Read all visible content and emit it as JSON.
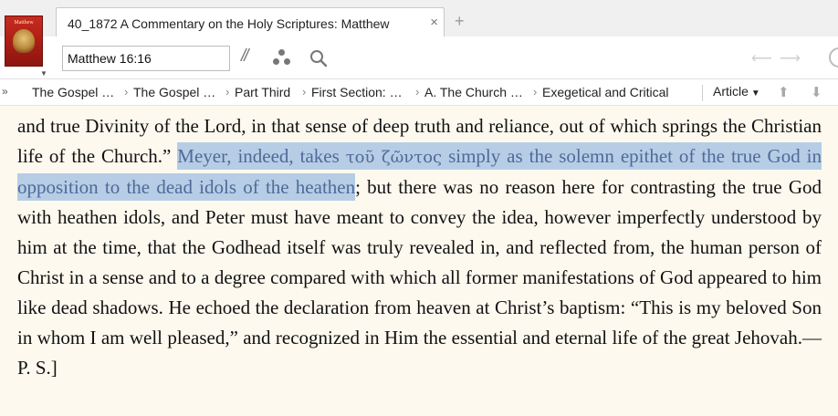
{
  "resource": {
    "cover_title": "Matthew"
  },
  "tab": {
    "title": "40_1872 A Commentary on the Holy Scriptures: Matthew",
    "close_glyph": "×",
    "new_tab_glyph": "+"
  },
  "toolbar": {
    "reference_value": "Matthew 16:16",
    "parallel_glyph": "//"
  },
  "breadcrumbs": {
    "overflow_glyph": "»",
    "items": [
      "The Gospel …",
      "The Gospel …",
      "Part Third",
      "First Section: …",
      "A. The Church …",
      "Exegetical and Critical"
    ],
    "separator": "›",
    "article_label": "Article"
  },
  "content": {
    "before": "and true Divinity of the Lord, in that sense of deep truth and reliance, out of which springs the Christian life of the Church.” ",
    "hl_a": "Meyer, indeed, takes ",
    "hl_greek": "τοῦ ζῶντος",
    "hl_b": "  simply as the solemn epithet of the true God in opposition to the dead idols of the heathen",
    "after": "; but there was no reason here for contrasting the true God with heathen idols, and Peter must have meant to convey the idea, however imperfectly understood by him at the time, that the Godhead itself was truly revealed in, and reflected from, the human person of Christ in a sense and to a degree compared with which all former manifestations of God appeared to him like dead shadows. He echoed the declaration from heaven at Christ’s baptism: “This is my beloved Son in whom I am well pleased,” and recognized in Him the essential and eternal life of the great Jehovah.—P. S.]"
  },
  "colors": {
    "highlight_bg": "#b7cde6",
    "highlight_text": "#4e6a98",
    "page_bg": "#fef9ef"
  }
}
